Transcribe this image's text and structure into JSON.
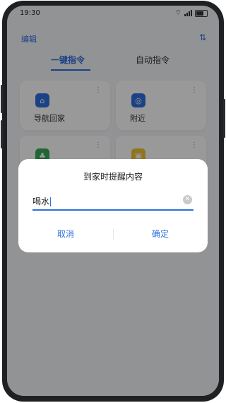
{
  "status_bar": {
    "time": "19:30"
  },
  "header": {
    "edit_label": "编辑",
    "top_right_icon": "sort-icon"
  },
  "tabs": [
    {
      "label": "一键指令",
      "active": true
    },
    {
      "label": "自动指令",
      "active": false
    }
  ],
  "cards": [
    {
      "label": "导航回家",
      "icon": "home-nav-icon",
      "color": "#2f6fe0"
    },
    {
      "label": "附近",
      "icon": "location-icon",
      "color": "#2f6fe0"
    },
    {
      "label": "",
      "icon": "green-app-icon",
      "color": "#3aaa5a"
    },
    {
      "label": "",
      "icon": "yellow-app-icon",
      "color": "#f1c232"
    }
  ],
  "dialog": {
    "title": "到家时提醒内容",
    "input_value": "喝水",
    "cancel_label": "取消",
    "ok_label": "确定"
  },
  "colors": {
    "accent": "#2f6fe0",
    "overlay": "rgba(0,0,0,0.40)"
  }
}
